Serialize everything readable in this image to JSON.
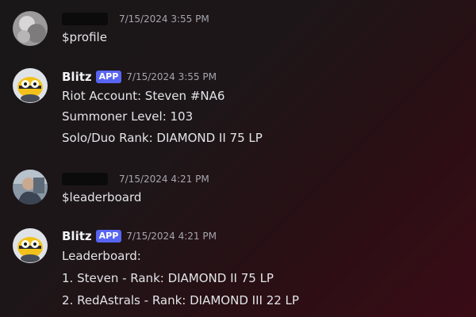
{
  "messages": [
    {
      "author": "",
      "author_redacted": true,
      "timestamp": "7/15/2024 3:55 PM",
      "avatar_icon": "gray-avatar-icon",
      "lines": [
        "$profile"
      ]
    },
    {
      "author": "Blitz",
      "badge": "APP",
      "timestamp": "7/15/2024 3:55 PM",
      "avatar_icon": "blitz-bee-avatar-icon",
      "lines": [
        "Riot Account: Steven #NA6",
        "Summoner Level: 103",
        "Solo/Duo Rank: DIAMOND II 75 LP"
      ]
    },
    {
      "author": "",
      "author_redacted": true,
      "timestamp": "7/15/2024 4:21 PM",
      "avatar_icon": "person-avatar-icon",
      "lines": [
        "$leaderboard"
      ]
    },
    {
      "author": "Blitz",
      "badge": "APP",
      "timestamp": "7/15/2024 4:21 PM",
      "avatar_icon": "blitz-bee-avatar-icon",
      "lines": [
        "Leaderboard:",
        "1. Steven - Rank: DIAMOND II 75 LP",
        "2. RedAstrals - Rank: DIAMOND III 22 LP"
      ]
    }
  ],
  "colors": {
    "badge": "#5865f2",
    "timestamp": "#a5a6ad",
    "background_accent": "#3a0c16"
  }
}
